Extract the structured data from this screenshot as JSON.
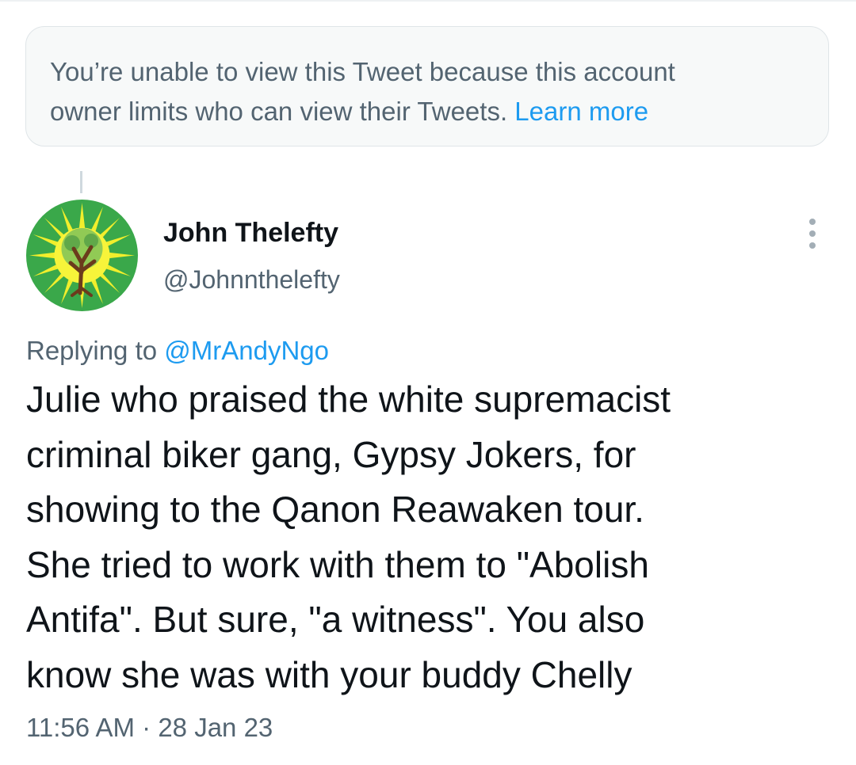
{
  "notice": {
    "line1": "You’re unable to view this Tweet because this account",
    "line2": "owner limits who can view their Tweets.",
    "link": "Learn more"
  },
  "author": {
    "display_name": "John Thelefty",
    "handle": "@Johnnthelefty",
    "avatar_icon": "green-sun-tree-icon"
  },
  "more_icon": "vertical-ellipsis-icon",
  "reply": {
    "prefix": "Replying to",
    "mention": "@MrAndyNgo"
  },
  "tweet": {
    "lines": [
      "Julie who praised the white supremacist",
      "criminal biker gang, Gypsy Jokers, for",
      "showing to the Qanon Reawaken tour.",
      "She tried to work with them to \"Abolish",
      "Antifa\". But sure, \"a witness\". You also",
      "know she was with your buddy Chelly"
    ],
    "time": "11:56 AM",
    "separator": "·",
    "date": "28 Jan 23"
  },
  "colors": {
    "accent": "#1d9bf0",
    "secondary_text": "#536471",
    "primary_text": "#0f1419",
    "notice_bg": "#f7f9f9"
  }
}
